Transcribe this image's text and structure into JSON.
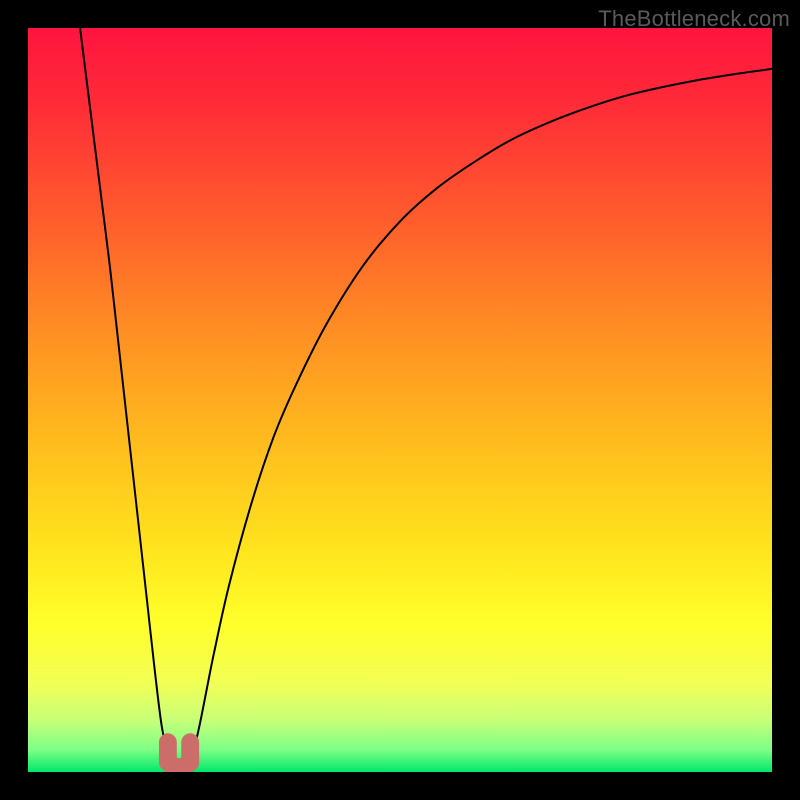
{
  "watermark": "TheBottleneck.com",
  "chart_data": {
    "type": "line",
    "title": "",
    "xlabel": "",
    "ylabel": "",
    "xlim": [
      0,
      100
    ],
    "ylim": [
      0,
      100
    ],
    "background_gradient": {
      "stops": [
        {
          "pos": 0.0,
          "color": "#ff1440"
        },
        {
          "pos": 0.1,
          "color": "#ff2b38"
        },
        {
          "pos": 0.25,
          "color": "#ff5a2d"
        },
        {
          "pos": 0.4,
          "color": "#ff8c24"
        },
        {
          "pos": 0.55,
          "color": "#ffba1e"
        },
        {
          "pos": 0.7,
          "color": "#ffe41e"
        },
        {
          "pos": 0.8,
          "color": "#ffff2a"
        },
        {
          "pos": 0.88,
          "color": "#f2ff55"
        },
        {
          "pos": 0.93,
          "color": "#c8ff78"
        },
        {
          "pos": 0.97,
          "color": "#7dff86"
        },
        {
          "pos": 1.0,
          "color": "#00e76a"
        }
      ]
    },
    "series": [
      {
        "name": "bottleneck-curve",
        "color": "#000000",
        "x": [
          7,
          8,
          9,
          10,
          11,
          12,
          13,
          14,
          15,
          16,
          17,
          18,
          19,
          20,
          21,
          22,
          23,
          24,
          25,
          27,
          30,
          33,
          36,
          40,
          45,
          50,
          55,
          60,
          65,
          70,
          75,
          80,
          85,
          90,
          95,
          100
        ],
        "y": [
          100,
          92,
          84,
          76,
          68,
          59,
          50,
          41,
          32,
          23,
          14,
          6,
          2,
          0.5,
          0.5,
          2,
          6,
          11,
          16,
          25,
          36,
          45,
          52,
          60,
          68,
          74,
          78.5,
          82,
          85,
          87.3,
          89.2,
          90.8,
          92,
          93,
          93.8,
          94.5
        ]
      }
    ],
    "marker": {
      "name": "minimum-u-marker",
      "color": "#cc6d6a",
      "x_range": [
        18.8,
        21.8
      ],
      "y_range": [
        0.5,
        4.0
      ],
      "thickness": 2.4
    }
  }
}
